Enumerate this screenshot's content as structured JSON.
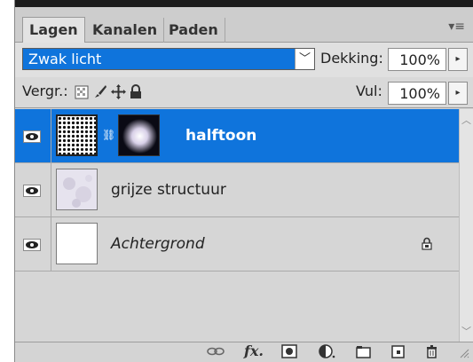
{
  "tabs": [
    {
      "label": "Lagen",
      "active": true
    },
    {
      "label": "Kanalen",
      "active": false
    },
    {
      "label": "Paden",
      "active": false
    }
  ],
  "blend": {
    "mode": "Zwak licht",
    "opacity_label": "Dekking:",
    "opacity_value": "100%"
  },
  "lock": {
    "label": "Vergr.:",
    "fill_label": "Vul:",
    "fill_value": "100%"
  },
  "layers": [
    {
      "name": "halftoon",
      "selected": true,
      "italic": false,
      "has_mask": true,
      "locked": false
    },
    {
      "name": "grijze structuur",
      "selected": false,
      "italic": false,
      "has_mask": false,
      "locked": false
    },
    {
      "name": "Achtergrond",
      "selected": false,
      "italic": true,
      "has_mask": false,
      "locked": true
    }
  ],
  "colors": {
    "selection": "#0f74dc",
    "panel": "#d6d6d6"
  },
  "bottom_icons": [
    "link-icon",
    "fx-icon",
    "mask-icon",
    "adjustment-icon",
    "folder-icon",
    "new-layer-icon",
    "trash-icon"
  ]
}
